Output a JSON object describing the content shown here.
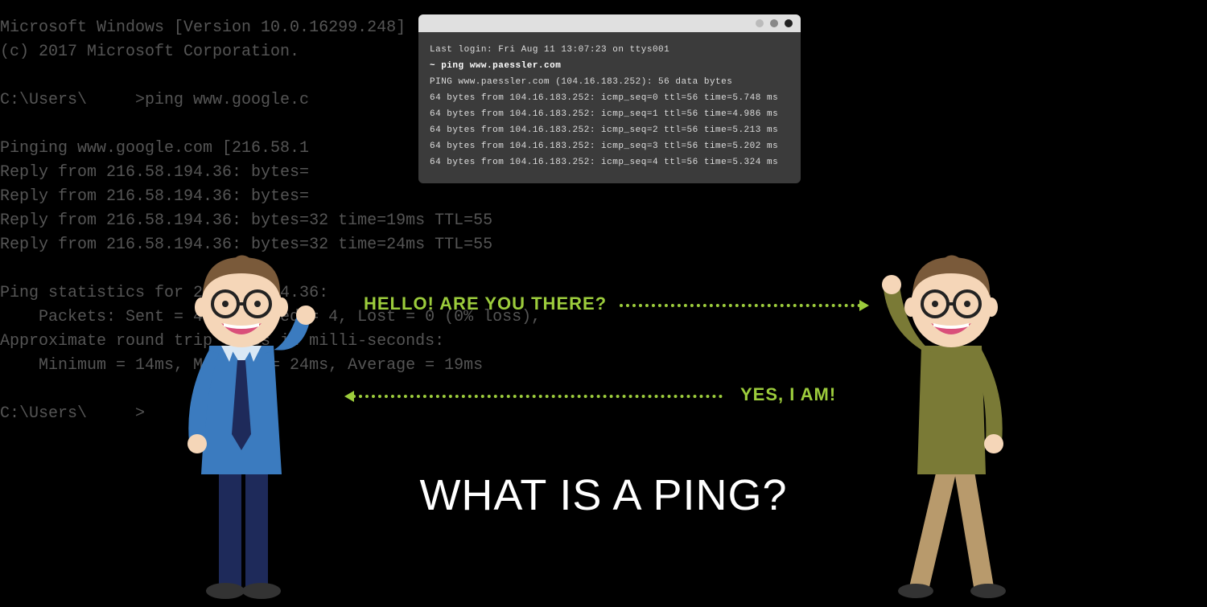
{
  "background_terminal": {
    "lines": [
      "Microsoft Windows [Version 10.0.16299.248]",
      "(c) 2017 Microsoft Corporation.",
      "",
      "C:\\Users\\     >ping www.google.c",
      "",
      "Pinging www.google.com [216.58.1",
      "Reply from 216.58.194.36: bytes=",
      "Reply from 216.58.194.36: bytes=",
      "Reply from 216.58.194.36: bytes=32 time=19ms TTL=55",
      "Reply from 216.58.194.36: bytes=32 time=24ms TTL=55",
      "",
      "Ping statistics for 216.58.194.36:",
      "    Packets: Sent = 4, Received = 4, Lost = 0 (0% loss),",
      "Approximate round trip times in milli-seconds:",
      "    Minimum = 14ms, Maximum = 24ms, Average = 19ms",
      "",
      "C:\\Users\\     >"
    ]
  },
  "mac_terminal": {
    "login": "Last login: Fri Aug 11 13:07:23 on ttys001",
    "prompt": " ~ ping www.paessler.com",
    "header": "PING www.paessler.com (104.16.183.252): 56 data bytes",
    "replies": [
      "64 bytes from 104.16.183.252: icmp_seq=0 ttl=56 time=5.748 ms",
      "64 bytes from 104.16.183.252: icmp_seq=1 ttl=56 time=4.986 ms",
      "64 bytes from 104.16.183.252: icmp_seq=2 ttl=56 time=5.213 ms",
      "64 bytes from 104.16.183.252: icmp_seq=3 ttl=56 time=5.202 ms",
      "64 bytes from 104.16.183.252: icmp_seq=4 ttl=56 time=5.324 ms"
    ]
  },
  "dialogue": {
    "question": "HELLO! ARE YOU THERE?",
    "answer": "YES, I AM!"
  },
  "title": "WHAT IS A PING?",
  "colors": {
    "accent": "#9ccc3c",
    "shirt_left": "#3b7bbf",
    "tie_left": "#1e2a5a",
    "shirt_right": "#7a7a36",
    "pants_right": "#b89a6c",
    "skin": "#f5d6b8",
    "hair": "#7a5a3a"
  }
}
